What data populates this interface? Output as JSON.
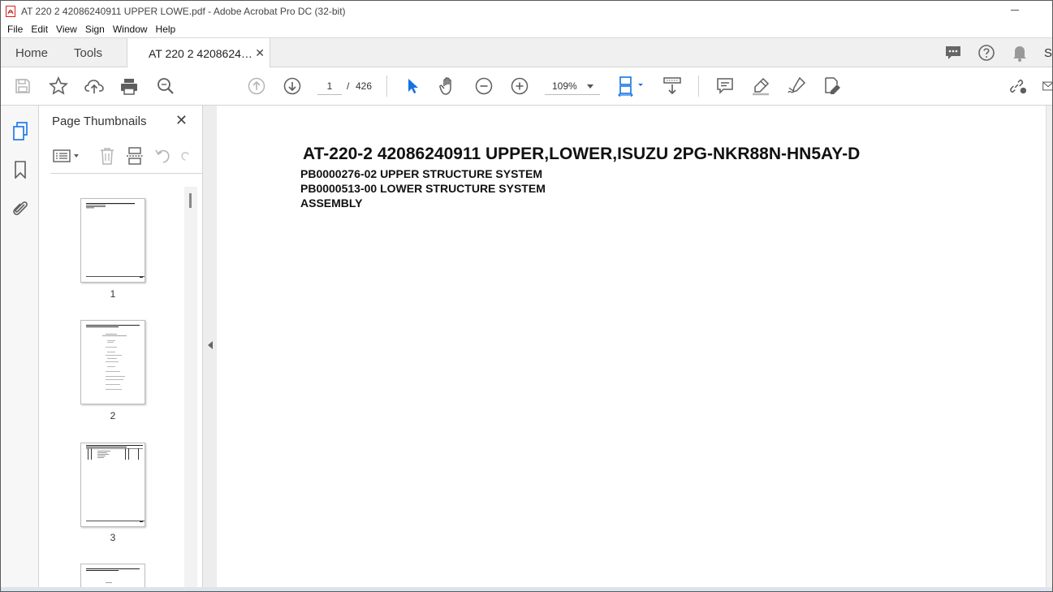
{
  "window": {
    "title": "AT 220 2 42086240911 UPPER LOWE.pdf - Adobe Acrobat Pro DC (32-bit)"
  },
  "menu": [
    "File",
    "Edit",
    "View",
    "Sign",
    "Window",
    "Help"
  ],
  "tabs": {
    "home": "Home",
    "tools": "Tools",
    "document": "AT 220 2 4208624…",
    "sign_partial": "S"
  },
  "toolbar": {
    "current_page": "1",
    "page_separator": "/",
    "total_pages": "426",
    "zoom": "109%"
  },
  "thumbnails_panel": {
    "title": "Page Thumbnails",
    "pages": [
      "1",
      "2",
      "3"
    ]
  },
  "document": {
    "title": "AT-220-2 42086240911 UPPER,LOWER,ISUZU 2PG-NKR88N-HN5AY-D",
    "lines": [
      "PB0000276-02 UPPER STRUCTURE SYSTEM",
      "PB0000513-00 LOWER STRUCTURE SYSTEM",
      "ASSEMBLY"
    ]
  },
  "colors": {
    "acrobat_red": "#d21f1f",
    "accent_blue": "#1473e6",
    "icon_gray": "#5e5e5e",
    "disabled_gray": "#b5b5b5"
  }
}
